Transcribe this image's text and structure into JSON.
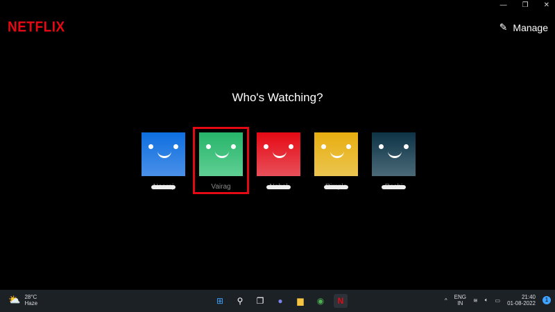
{
  "window": {
    "minimize": "—",
    "restore": "❐",
    "close": "✕"
  },
  "brand": "NETFLIX",
  "manage_label": "Manage",
  "heading": "Who's Watching?",
  "profiles": [
    {
      "name": "Neeraj",
      "color_top": "#0e6fe0",
      "color_bottom": "#4a90e8",
      "redacted": true
    },
    {
      "name": "Vairag",
      "color_top": "#27b46a",
      "color_bottom": "#5fcf93",
      "redacted": false,
      "selected": true
    },
    {
      "name": "Nehal",
      "color_top": "#e50914",
      "color_bottom": "#e8505a",
      "redacted": true
    },
    {
      "name": "Rimple",
      "color_top": "#e8ae10",
      "color_bottom": "#ebc550",
      "redacted": true
    },
    {
      "name": "Rashi",
      "color_top": "#0c3345",
      "color_bottom": "#4b6a78",
      "redacted": true
    }
  ],
  "taskbar": {
    "temp": "28°C",
    "weather": "Haze",
    "lang": "ENG",
    "region": "IN",
    "time": "21:40",
    "date": "01-08-2022",
    "notifications": "1"
  }
}
